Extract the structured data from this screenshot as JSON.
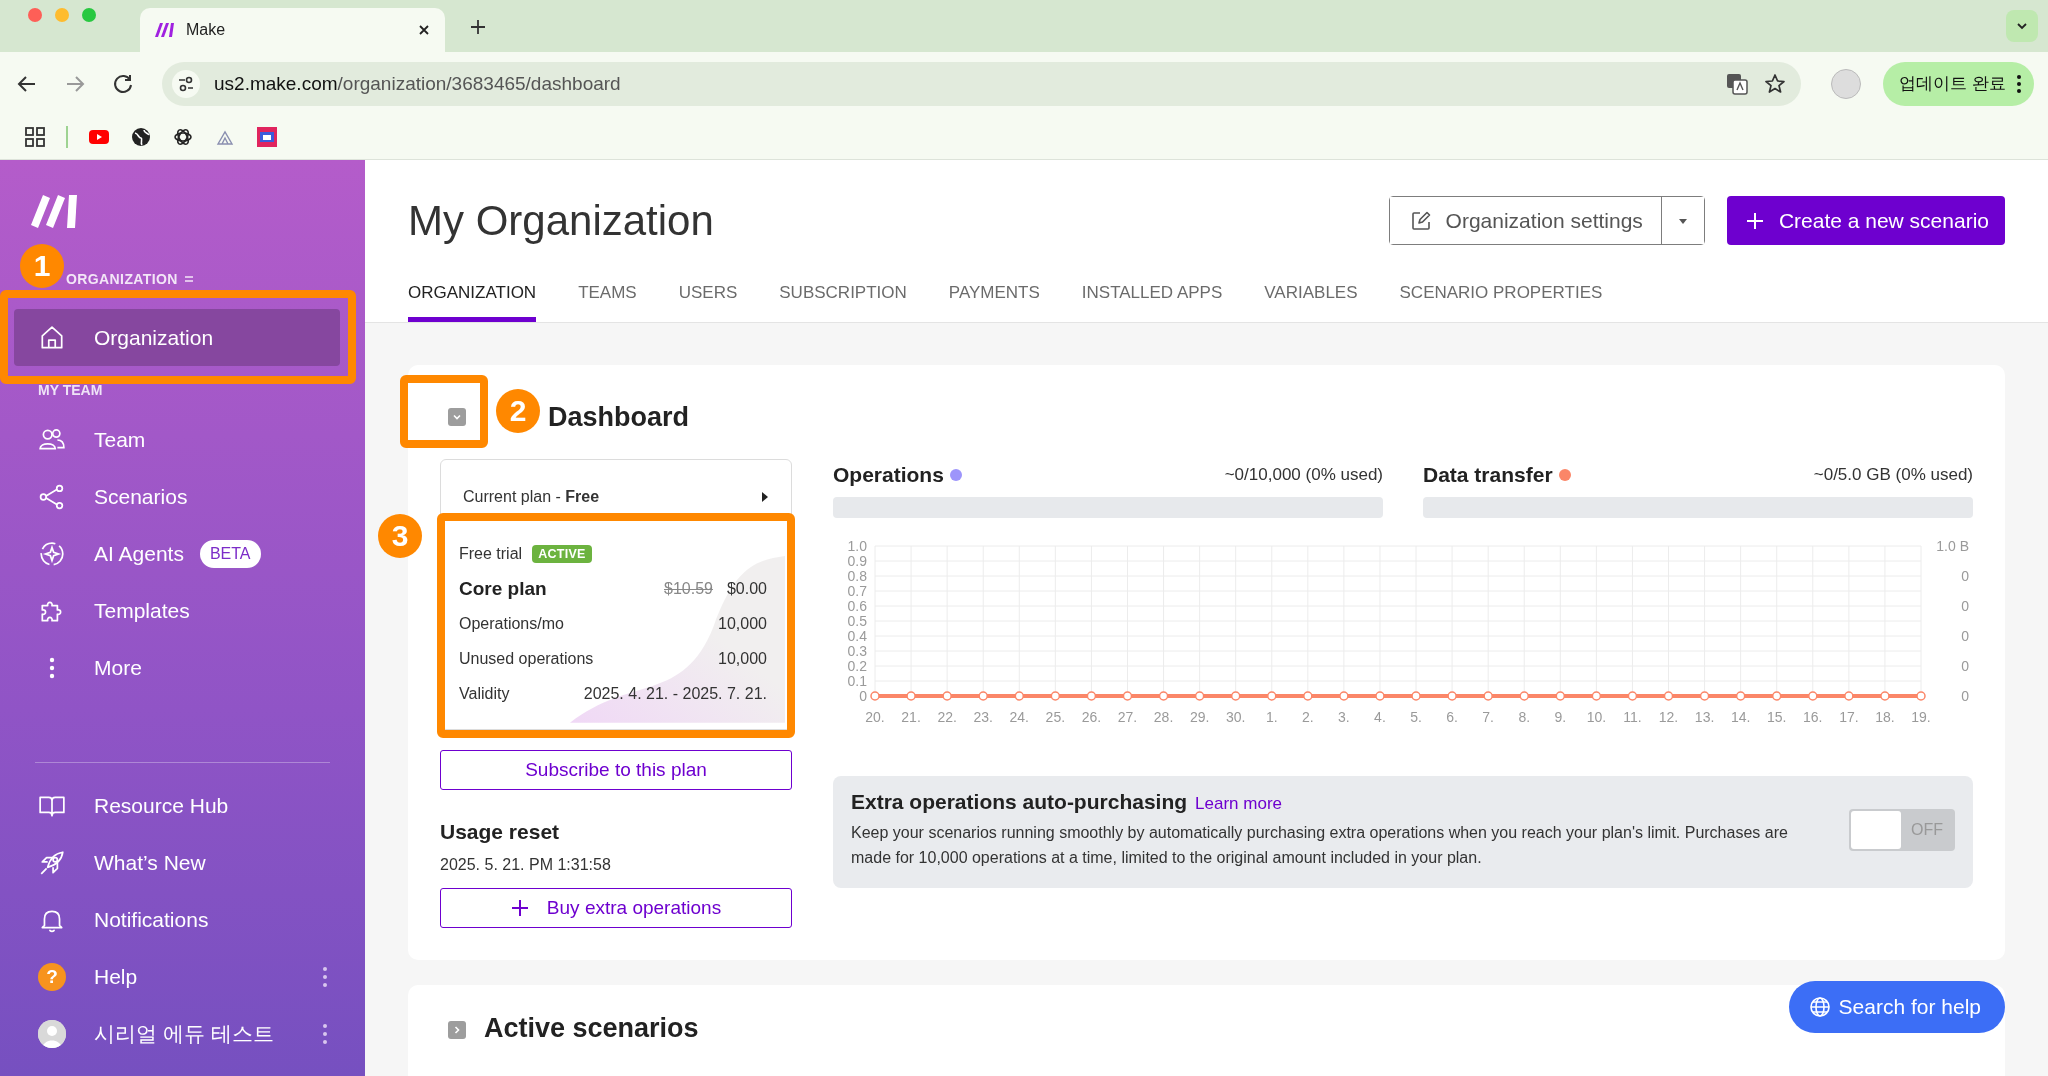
{
  "browser": {
    "tab_title": "Make",
    "url_host": "us2.make.com",
    "url_path": "/organization/3683465/dashboard",
    "update_button": "업데이트 완료"
  },
  "sidebar": {
    "org_label": "ORGANIZATION",
    "org_items": [
      {
        "label": "Organization",
        "selected": true
      }
    ],
    "team_label": "MY TEAM",
    "team_items": [
      {
        "label": "Team",
        "selected": false
      },
      {
        "label": "Scenarios",
        "selected": false
      },
      {
        "label": "AI Agents",
        "badge": "BETA",
        "selected": false
      },
      {
        "label": "Templates",
        "selected": false
      },
      {
        "label": "More",
        "selected": false
      }
    ],
    "bottom_items": [
      {
        "label": "Resource Hub",
        "menu": false
      },
      {
        "label": "What’s New",
        "menu": false
      },
      {
        "label": "Notifications",
        "menu": false
      },
      {
        "label": "Help",
        "icon_text": "?",
        "menu": true
      },
      {
        "label": "시리얼 에듀 테스트",
        "menu": true
      }
    ]
  },
  "header": {
    "title": "My Organization",
    "settings_button": "Organization settings",
    "create_button": "Create a new scenario",
    "tabs": [
      {
        "label": "ORGANIZATION",
        "selected": true
      },
      {
        "label": "TEAMS",
        "selected": false
      },
      {
        "label": "USERS",
        "selected": false
      },
      {
        "label": "SUBSCRIPTION",
        "selected": false
      },
      {
        "label": "PAYMENTS",
        "selected": false
      },
      {
        "label": "INSTALLED APPS",
        "selected": false
      },
      {
        "label": "VARIABLES",
        "selected": false
      },
      {
        "label": "SCENARIO PROPERTIES",
        "selected": false
      }
    ]
  },
  "dashboard": {
    "title": "Dashboard",
    "expanded": true,
    "plan": {
      "current": "Current plan - **Free**",
      "trial_label": "Free trial",
      "status": "ACTIVE",
      "name": "Core plan",
      "old_price": "$10.59",
      "price": "$0.00",
      "rows": [
        {
          "label": "Operations/mo",
          "value": "10,000"
        },
        {
          "label": "Unused operations",
          "value": "10,000"
        },
        {
          "label": "Validity",
          "value": "2025. 4. 21. - 2025. 7. 21."
        }
      ]
    },
    "subscribe_button": "Subscribe to this plan",
    "usage_reset": {
      "title": "Usage reset",
      "date": "2025. 5. 21. PM 1:31:58"
    },
    "buy_button": "Buy extra operations",
    "usage": [
      {
        "name": "Operations",
        "color": "#9d95fb",
        "reading": "~0/10,000 (0% used)",
        "level": 0
      },
      {
        "reading": "~0/5.0 GB (0% used)",
        "level": 0
      }
    ],
    "chart_data": {
      "type": "line",
      "grid": true,
      "categories": [
        "20.",
        "21.",
        "22.",
        "23.",
        "24.",
        "25.",
        "26.",
        "27.",
        "28.",
        "29.",
        "30.",
        "1.",
        "2.",
        "3.",
        "4.",
        "5.",
        "6.",
        "7.",
        "8.",
        "9.",
        "10.",
        "11.",
        "12.",
        "13.",
        "14.",
        "15.",
        "16.",
        "17.",
        "18.",
        "19."
      ],
      "ylim": [
        0,
        1
      ],
      "yticks": [
        0,
        0.1,
        0.2,
        0.3,
        0.4,
        0.5,
        0.6,
        0.7,
        0.8,
        0.9,
        {
          "value": 1,
          "label": "1.0"
        }
      ],
      "series": [
        {
          "name": "Data transfer",
          "color": "#fb8668",
          "marker": "circle",
          "values": [
            0,
            0,
            0,
            0,
            0,
            0,
            0,
            0,
            0,
            0,
            0,
            0,
            0,
            0,
            0,
            0,
            0,
            0,
            0,
            0,
            0,
            0,
            0,
            0,
            0,
            0,
            0,
            0,
            0,
            0
          ]
        }
      ]
    },
    "right_axis_labels": [
      "1.0 B",
      "0",
      "0",
      "0",
      "0",
      "0"
    ],
    "auto_purchase": {
      "title": "Extra operations auto-purchasing",
      "link": "Learn more",
      "text": "Keep your scenarios running smoothly by automatically purchasing extra operations when you reach your plan's limit. Purchases are made for 10,000 operations at a time, limited to the original amount included in your plan.",
      "on": false,
      "off_label": "OFF"
    }
  },
  "active_scenarios": {
    "title": "Active scenarios",
    "expanded": false
  },
  "help_button": "Search for help",
  "annotations": [
    "1",
    "2",
    "3"
  ]
}
